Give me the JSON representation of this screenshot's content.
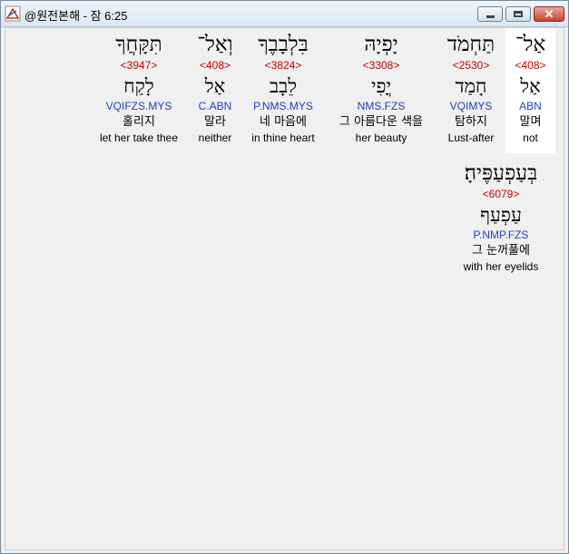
{
  "window": {
    "title": "@원전본해 - 잠 6:25",
    "minimize_label": "",
    "maximize_label": "",
    "close_label": "✕"
  },
  "words": [
    {
      "hebrew": "אַל־",
      "strong": "<408>",
      "root": "אַל",
      "morph": "ABN",
      "korean": "말며",
      "english": "not"
    },
    {
      "hebrew": "תַּחְמֹד",
      "strong": "<2530>",
      "root": "חָמַד",
      "morph": "VQIMYS",
      "korean": "탐하지",
      "english": "Lust-after"
    },
    {
      "hebrew": "יָפְיָהּ",
      "strong": "<3308>",
      "root": "יֳפִי",
      "morph": "NMS.FZS",
      "korean": "그 아름다운 색을",
      "english": "her beauty"
    },
    {
      "hebrew": "בִּלְבָבֶךָ",
      "strong": "<3824>",
      "root": "לֵבָב",
      "morph": "P.NMS.MYS",
      "korean": "네 마음에",
      "english": "in thine heart"
    },
    {
      "hebrew": "וְאַל־",
      "strong": "<408>",
      "root": "אַל",
      "morph": "C.ABN",
      "korean": "말라",
      "english": "neither"
    },
    {
      "hebrew": "תִּקָּחֲךָ",
      "strong": "<3947>",
      "root": "לָקַח",
      "morph": "VQIFZS.MYS",
      "korean": "홀리지",
      "english": "let her take thee"
    },
    {
      "hebrew": "בְּעַפְעַפֶּיהָ׃",
      "strong": "<6079>",
      "root": "עַפְעַף",
      "morph": "P.NMP.FZS",
      "korean": "그 눈꺼풀에",
      "english": "with her eyelids"
    }
  ]
}
